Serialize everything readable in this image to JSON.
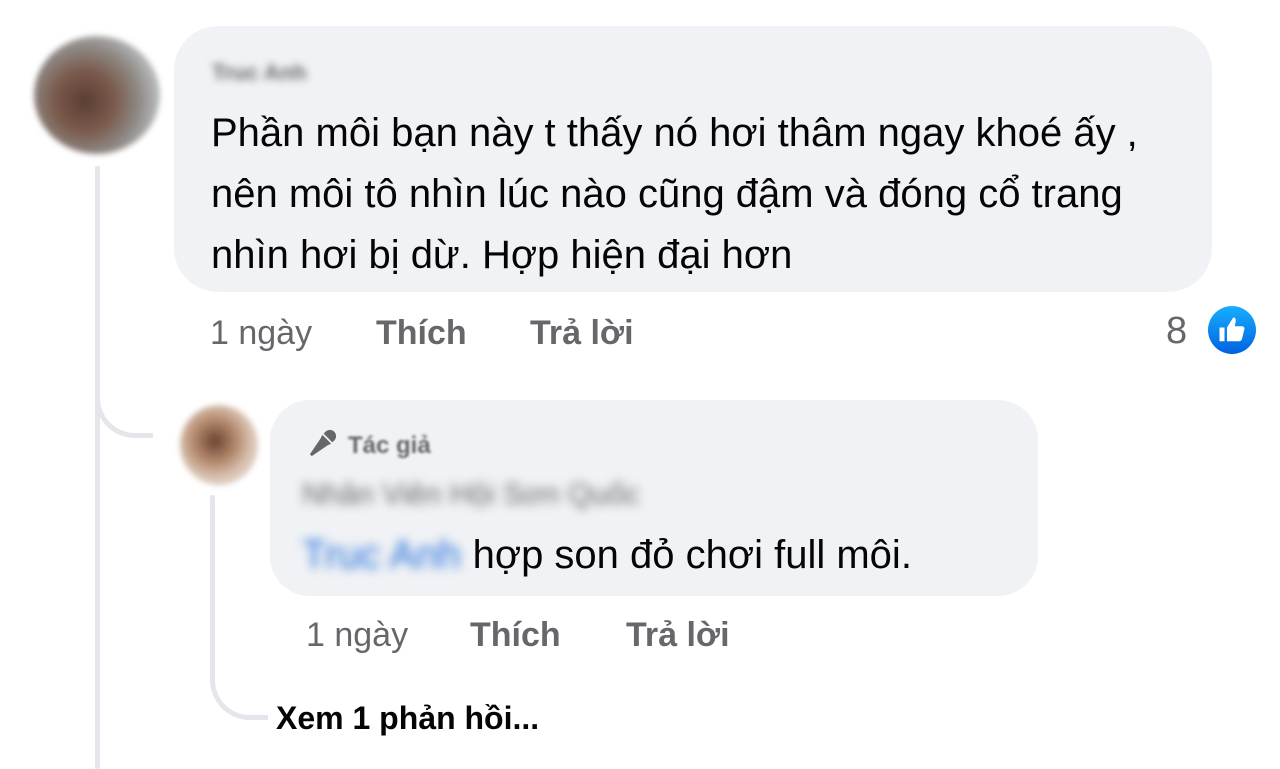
{
  "comment": {
    "author_name": "Truc Anh",
    "text": "Phần môi bạn này t thấy nó hơi thâm ngay khoé ấy , nên môi tô nhìn lúc nào cũng đậm và đóng cổ trang nhìn hơi bị dừ. Hợp hiện đại hơn",
    "time": "1 ngày",
    "like_label": "Thích",
    "reply_label": "Trả lời",
    "reaction_count": "8",
    "reaction_icon": "thumbs-up-icon"
  },
  "reply": {
    "author_badge": "Tác giả",
    "author_badge_icon": "microphone-icon",
    "author_name": "Nhân Viên Hội Sơn Quốc",
    "mention": "Truc Anh",
    "text": "hợp son đỏ chơi full môi.",
    "time": "1 ngày",
    "like_label": "Thích",
    "reply_label": "Trả lời"
  },
  "view_more_replies": "Xem 1 phản hồi...",
  "colors": {
    "bubble": "#f0f2f5",
    "meta_text": "#65676b",
    "like_blue": "#0866ff",
    "mention_blue": "#216fdb"
  }
}
